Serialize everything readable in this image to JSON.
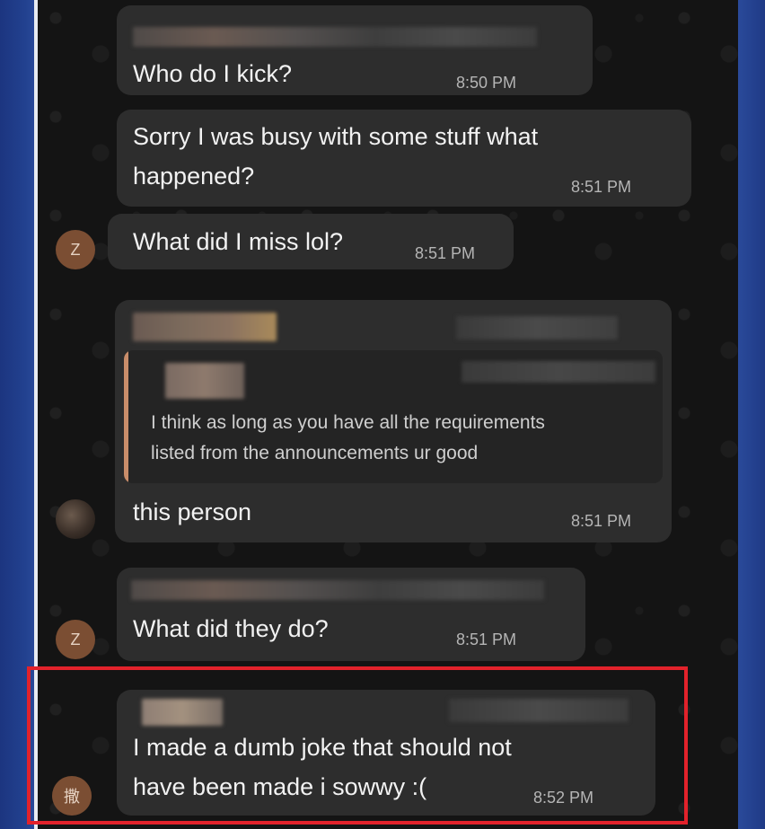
{
  "messages": [
    {
      "text": "Who do I kick?",
      "time": "8:50 PM"
    },
    {
      "text_line1": "Sorry I was busy with some stuff what",
      "text_line2": "happened?",
      "time": "8:51 PM"
    },
    {
      "avatar_letter": "Z",
      "text": "What did I miss lol?",
      "time": "8:51 PM"
    },
    {
      "quote_line1": "I think as long as you have all the requirements",
      "quote_line2": "listed from the announcements ur good",
      "text": "this person",
      "time": "8:51 PM"
    },
    {
      "avatar_letter": "Z",
      "text": "What did they do?",
      "time": "8:51 PM"
    },
    {
      "avatar_letter": "撒",
      "text_line1": "I made a dumb joke that should not",
      "text_line2": "have been made i sowwy :(",
      "time": "8:52 PM"
    }
  ],
  "colors": {
    "chat_background": "#141414",
    "bubble": "#2d2d2d",
    "avatar": "#7b4e33",
    "quote_bar": "#c98d6a",
    "highlight_border": "#e2222b",
    "frame_blue": "#1d3a86"
  }
}
